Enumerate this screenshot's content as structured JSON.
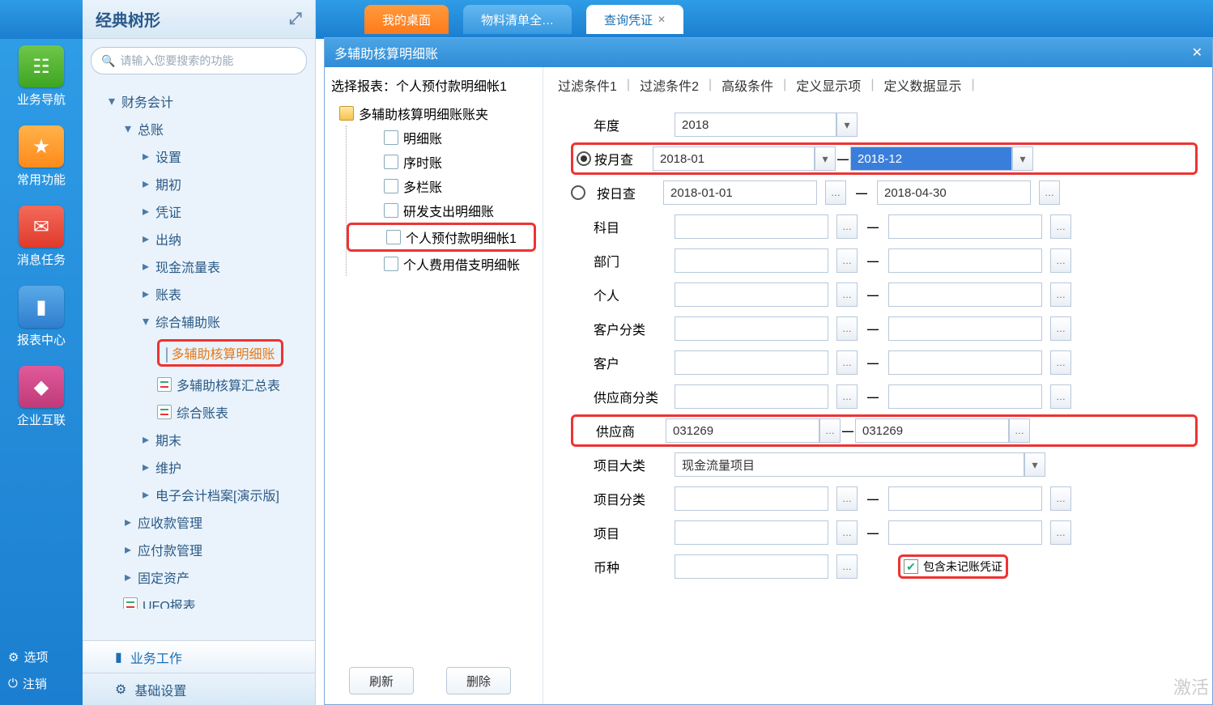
{
  "top_tabs": {
    "t0": "我的桌面",
    "t1": "物料清单全…",
    "t2": "查询凭证"
  },
  "left_nav": {
    "i0": "业务导航",
    "i1": "常用功能",
    "i2": "消息任务",
    "i3": "报表中心",
    "i4": "企业互联",
    "opt": "选项",
    "logout": "注销"
  },
  "sidebar": {
    "title": "经典树形",
    "search_placeholder": "请输入您要搜索的功能",
    "n_caiwu": "财务会计",
    "n_zongzhang": "总账",
    "n_shezhi": "设置",
    "n_qichu": "期初",
    "n_pingzheng": "凭证",
    "n_chuna": "出纳",
    "n_xianjin": "现金流量表",
    "n_zhangbiao": "账表",
    "n_zonghe": "综合辅助账",
    "n_mingxi": "多辅助核算明细账",
    "n_huizong": "多辅助核算汇总表",
    "n_zongbiao": "综合账表",
    "n_qimo": "期末",
    "n_weihu": "维护",
    "n_dianzi": "电子会计档案[演示版]",
    "n_yingshoukuan": "应收款管理",
    "n_yingfukuan": "应付款管理",
    "n_guding": "固定资产",
    "n_ufo": "UFO报表",
    "f_yewu": "业务工作",
    "f_jichu": "基础设置"
  },
  "dialog": {
    "title": "多辅助核算明细账",
    "left_title": "选择报表：个人预付款明细帐1",
    "tree_root": "多辅助核算明细账账夹",
    "tr0": "明细账",
    "tr1": "序时账",
    "tr2": "多栏账",
    "tr3": "研发支出明细账",
    "tr4": "个人预付款明细帐1",
    "tr5": "个人费用借支明细帐",
    "btn_refresh": "刷新",
    "btn_delete": "删除",
    "tabs": {
      "t0": "过滤条件1",
      "t1": "过滤条件2",
      "t2": "高级条件",
      "t3": "定义显示项",
      "t4": "定义数据显示"
    },
    "form": {
      "year_label": "年度",
      "year_value": "2018",
      "by_month": "按月查",
      "by_day": "按日查",
      "month_from": "2018-01",
      "month_to": "2018-12",
      "day_from": "2018-01-01",
      "day_to": "2018-04-30",
      "kemu": "科目",
      "bumen": "部门",
      "geren": "个人",
      "kehufenlei": "客户分类",
      "kehu": "客户",
      "gysfenlei": "供应商分类",
      "gys": "供应商",
      "gys_from": "031269",
      "gys_to": "031269",
      "xmdl": "项目大类",
      "xmdl_val": "现金流量项目",
      "xmfl": "项目分类",
      "xm": "项目",
      "bizhong": "币种",
      "include_unposted": "包含未记账凭证"
    }
  },
  "watermark": "激活"
}
